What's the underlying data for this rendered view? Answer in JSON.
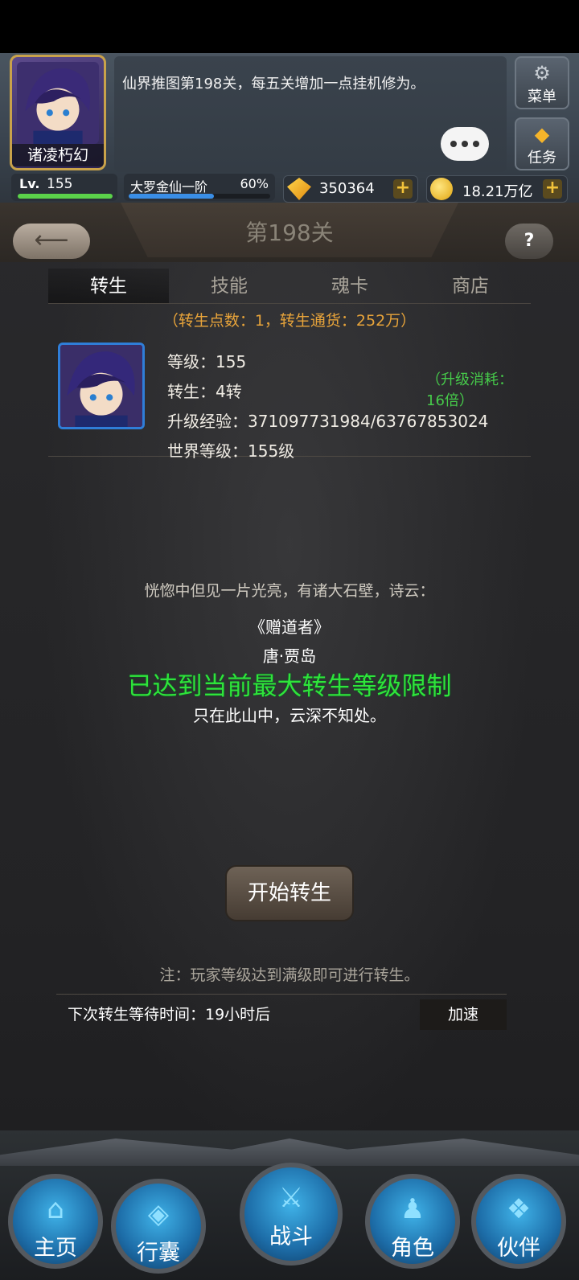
{
  "hud": {
    "player_name": "诸凌朽幻",
    "chat_message": "仙界推图第198关，每五关增加一点挂机修为。",
    "menu_label": "菜单",
    "task_label": "任务",
    "level_label": "Lv.",
    "level_value": "155",
    "realm_name": "大罗金仙一阶",
    "realm_progress": "60%",
    "gems": "350364",
    "gold": "18.21万亿"
  },
  "stage": {
    "title": "第198关"
  },
  "tabs": [
    {
      "label": "转生"
    },
    {
      "label": "技能"
    },
    {
      "label": "魂卡"
    },
    {
      "label": "商店"
    }
  ],
  "rebirth": {
    "points_line": "（转生点数：1，转生通货：252万）",
    "level": "等级：155",
    "rebirth": "转生：4转",
    "exp": "升级经验：371097731984/63767853024",
    "world_level": "世界等级：155级",
    "upgrade_cost": "（升级消耗：16倍）",
    "poem_intro": "恍惚中但见一片光亮，有诸大石壁，诗云：",
    "poem_title": "《赠道者》",
    "poem_author": "唐·贾岛",
    "poem_line": "只在此山中，云深不知处。",
    "max_notice": "已达到当前最大转生等级限制",
    "start_button": "开始转生",
    "note": "注：玩家等级达到满级即可进行转生。",
    "wait_text": "下次转生等待时间：19小时后",
    "speed_button": "加速"
  },
  "nav": {
    "home": "主页",
    "bag": "行囊",
    "battle": "战斗",
    "role": "角色",
    "partner": "伙伴"
  },
  "colors": {
    "accent_green": "#2fe43a",
    "points_orange": "#e8a43a",
    "cost_green": "#46c94a"
  }
}
